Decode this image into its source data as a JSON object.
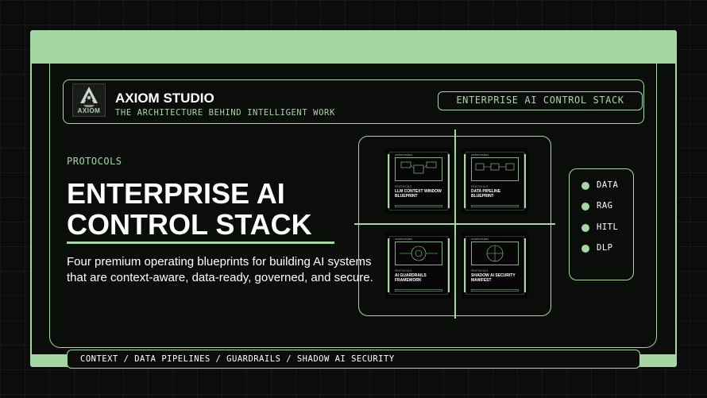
{
  "brand": {
    "name": "AXIOM STUDIO",
    "tagline": "THE ARCHITECTURE BEHIND INTELLIGENT WORK",
    "logo_wordmark": "AXIOM",
    "logo_icon": "helmet-emblem-icon"
  },
  "header": {
    "pill_label": "ENTERPRISE AI CONTROL STACK"
  },
  "hero": {
    "eyebrow": "PROTOCOLS",
    "title_line1": "ENTERPRISE AI",
    "title_line2": "CONTROL STACK",
    "description": "Four premium operating blueprints for building AI systems that are context-aware, data-ready, governed, and secure."
  },
  "blueprints": [
    {
      "title": "LLM CONTEXT WINDOW BLUEPRINT"
    },
    {
      "title": "DATA PIPELINE BLUEPRINT"
    },
    {
      "title": "AI GUARDRAILS FRAMEWORK"
    },
    {
      "title": "SHADOW AI SECURITY MANIFEST"
    }
  ],
  "tags": [
    {
      "label": "DATA"
    },
    {
      "label": "RAG"
    },
    {
      "label": "HITL"
    },
    {
      "label": "DLP"
    }
  ],
  "footer": {
    "label": "CONTEXT / DATA PIPELINES / GUARDRAILS / SHADOW AI SECURITY"
  },
  "colors": {
    "accent": "#a4d7a2",
    "background": "#0b0c0b",
    "text": "#ffffff"
  }
}
